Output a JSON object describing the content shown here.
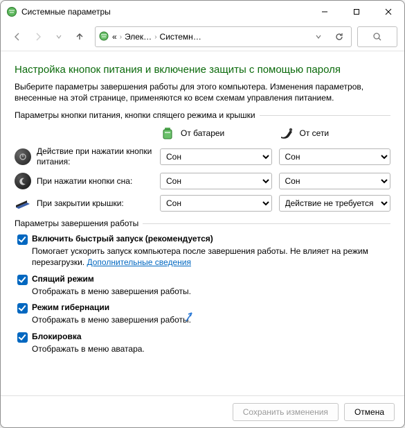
{
  "window": {
    "title": "Системные параметры"
  },
  "breadcrumb": {
    "item1": "Элек…",
    "item2": "Системн…"
  },
  "page": {
    "title": "Настройка кнопок питания и включение защиты с помощью пароля",
    "intro": "Выберите параметры завершения работы для этого компьютера. Изменения параметров, внесенные на этой странице, применяются ко всем схемам управления питанием.",
    "group1_label": "Параметры кнопки питания, кнопки спящего режима и крышки",
    "col_battery": "От батареи",
    "col_ac": "От сети",
    "row_power_label": "Действие при нажатии кнопки питания:",
    "row_sleep_label": "При нажатии кнопки сна:",
    "row_lid_label": "При закрытии крышки:",
    "val_sleep": "Сон",
    "val_noaction": "Действие не требуется",
    "group2_label": "Параметры завершения работы",
    "chk_fast_title": "Включить быстрый запуск (рекомендуется)",
    "chk_fast_desc_a": "Помогает ускорить запуск компьютера после завершения работы. Не влияет на режим перезагрузки. ",
    "chk_fast_link": "Дополнительные сведения",
    "chk_sleep_title": "Спящий режим",
    "chk_sleep_desc": "Отображать в меню завершения работы.",
    "chk_hib_title": "Режим гибернации",
    "chk_hib_desc": "Отображать в меню завершения работы.",
    "chk_lock_title": "Блокировка",
    "chk_lock_desc": "Отображать в меню аватара."
  },
  "footer": {
    "save": "Сохранить изменения",
    "cancel": "Отмена"
  }
}
